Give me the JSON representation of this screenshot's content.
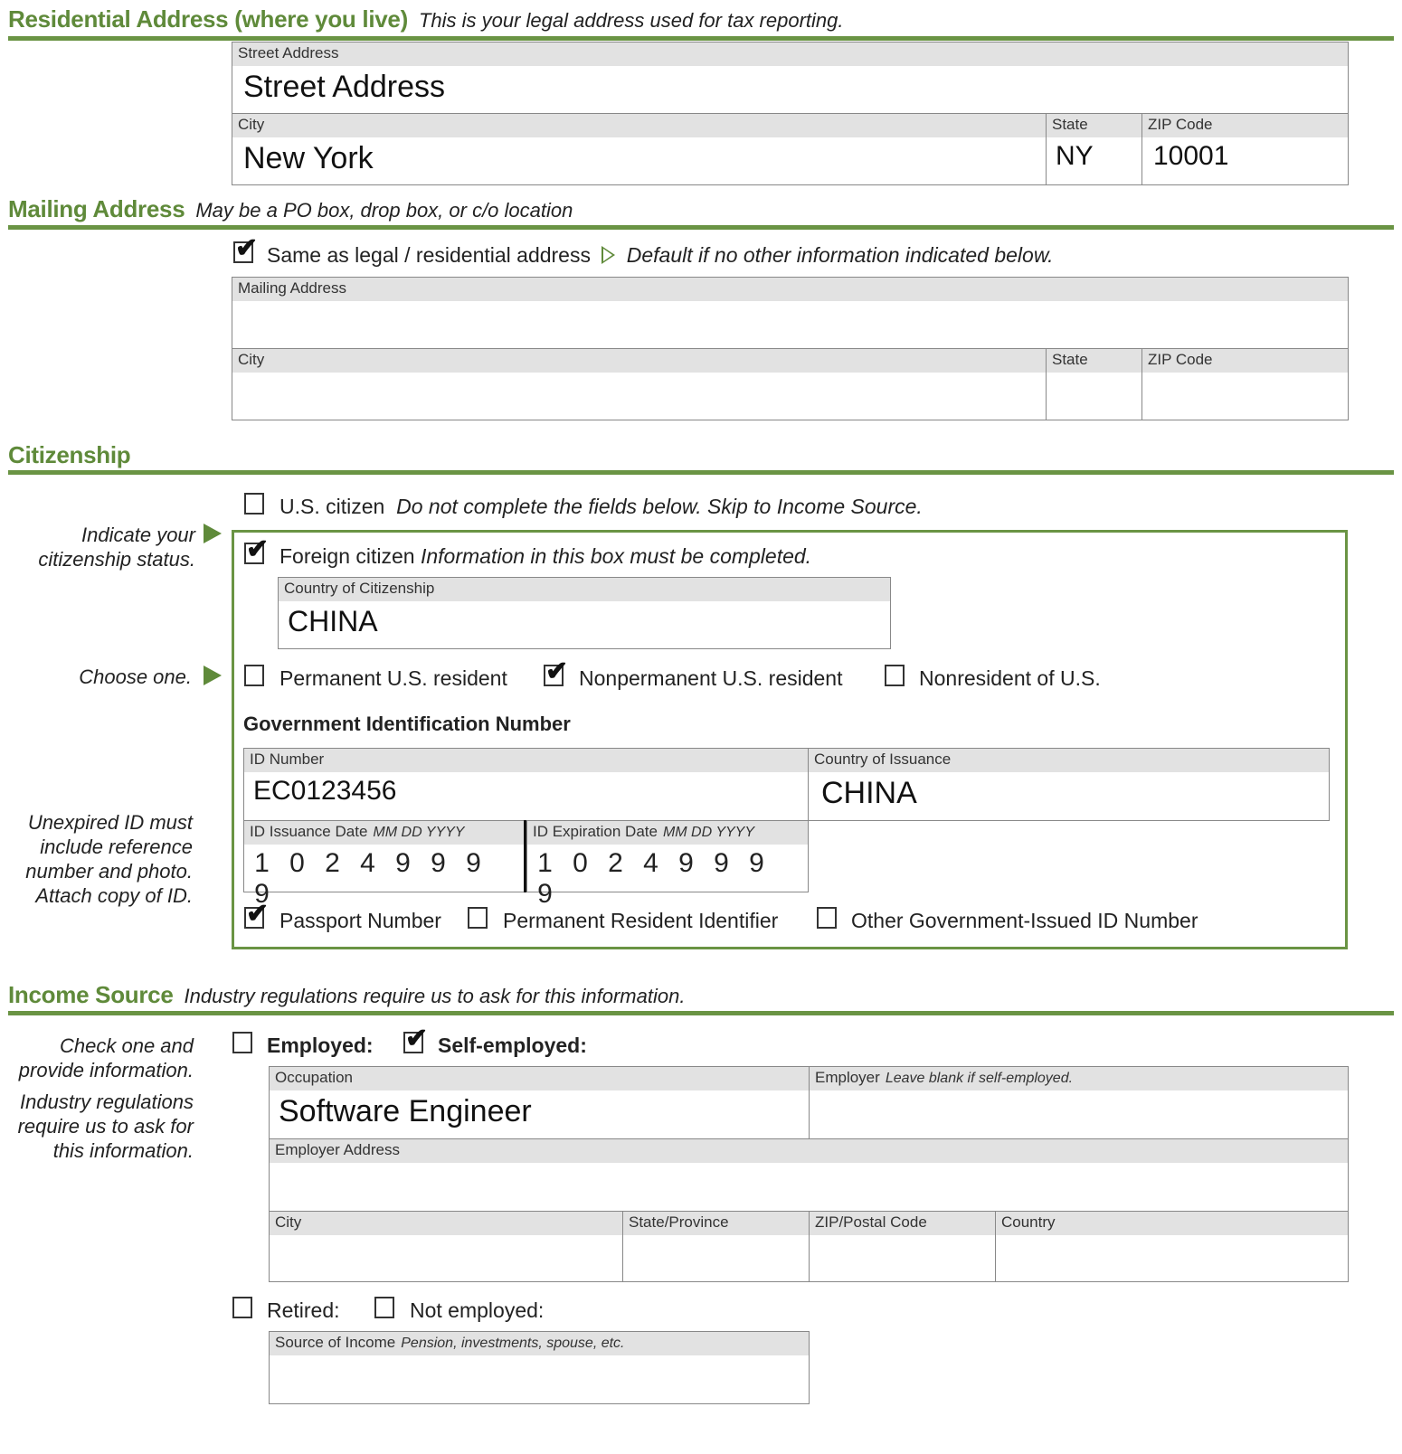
{
  "residential": {
    "title": "Residential Address (where you live)",
    "subtitle": "This is your legal address used for tax reporting.",
    "street_label": "Street Address",
    "street_value": "Street Address",
    "city_label": "City",
    "city_value": "New York",
    "state_label": "State",
    "state_value": "NY",
    "zip_label": "ZIP Code",
    "zip_value": "10001"
  },
  "mailing": {
    "title": "Mailing Address",
    "subtitle": "May be a PO box, drop box, or c/o location",
    "same_as_label": "Same as legal / residential address",
    "same_as_checked": true,
    "same_as_note": "Default if no other information indicated below.",
    "address_label": "Mailing Address",
    "address_value": "",
    "city_label": "City",
    "city_value": "",
    "state_label": "State",
    "state_value": "",
    "zip_label": "ZIP Code",
    "zip_value": ""
  },
  "citizenship": {
    "title": "Citizenship",
    "side_note_1": "Indicate your citizenship status.",
    "side_note_2": "Choose one.",
    "side_note_3": "Unexpired ID must include reference number and photo. Attach copy of ID.",
    "us_citizen_label": "U.S. citizen",
    "us_citizen_note": "Do not complete the fields below. Skip to Income Source.",
    "us_citizen_checked": false,
    "foreign_label": "Foreign citizen",
    "foreign_note": "Information in this box must be completed.",
    "foreign_checked": true,
    "country_label": "Country of Citizenship",
    "country_value": "CHINA",
    "residency_options": [
      {
        "label": "Permanent U.S. resident",
        "checked": false
      },
      {
        "label": "Nonpermanent U.S. resident",
        "checked": true
      },
      {
        "label": "Nonresident of U.S.",
        "checked": false
      }
    ],
    "gov_id_heading": "Government Identification Number",
    "id_number_label": "ID Number",
    "id_number_value": "EC0123456",
    "issuance_country_label": "Country of Issuance",
    "issuance_country_value": "CHINA",
    "issue_date_label": "ID Issuance Date",
    "issue_date_format": "MM DD YYYY",
    "issue_date_digits": [
      "1",
      "0",
      "2",
      "4",
      "9",
      "9",
      "9",
      "9"
    ],
    "exp_date_label": "ID Expiration Date",
    "exp_date_format": "MM DD YYYY",
    "exp_date_digits": [
      "1",
      "0",
      "2",
      "4",
      "9",
      "9",
      "9",
      "9"
    ],
    "id_type_options": [
      {
        "label": "Passport Number",
        "checked": true
      },
      {
        "label": "Permanent Resident Identifier",
        "checked": false
      },
      {
        "label": "Other Government-Issued ID Number",
        "checked": false
      }
    ]
  },
  "income": {
    "title": "Income Source",
    "subtitle": "Industry regulations require us to ask for this information.",
    "side_note_1": "Check one and provide information.",
    "side_note_2": "Industry regulations require us to ask for this information.",
    "employed_label": "Employed:",
    "employed_checked": false,
    "self_employed_label": "Self-employed:",
    "self_employed_checked": true,
    "occupation_label": "Occupation",
    "occupation_value": "Software Engineer",
    "employer_label": "Employer",
    "employer_note": "Leave blank if self-employed.",
    "employer_value": "",
    "employer_address_label": "Employer Address",
    "employer_address_value": "",
    "city_label": "City",
    "state_label": "State/Province",
    "zip_label": "ZIP/Postal Code",
    "country_label": "Country",
    "retired_label": "Retired:",
    "retired_checked": false,
    "not_employed_label": "Not employed:",
    "not_employed_checked": false,
    "source_label": "Source of Income",
    "source_note": "Pension, investments, spouse, etc.",
    "source_value": ""
  },
  "icons": {
    "check_glyph": "✔"
  }
}
